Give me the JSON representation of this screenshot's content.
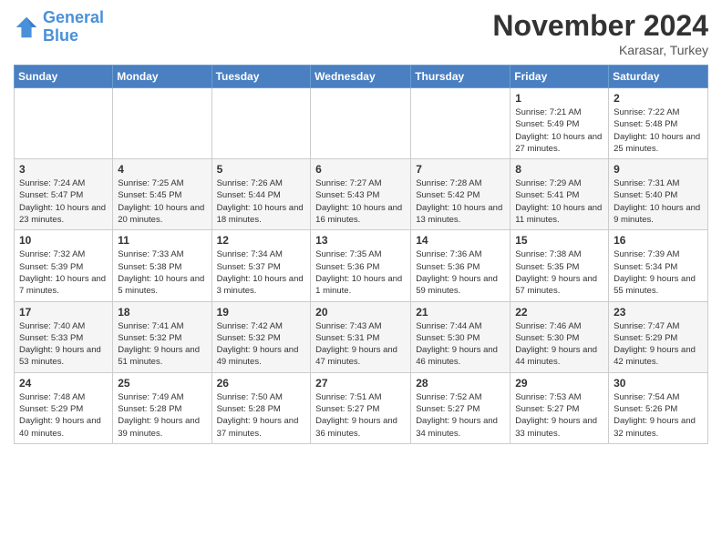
{
  "logo": {
    "line1": "General",
    "line2": "Blue"
  },
  "title": "November 2024",
  "location": "Karasar, Turkey",
  "days_header": [
    "Sunday",
    "Monday",
    "Tuesday",
    "Wednesday",
    "Thursday",
    "Friday",
    "Saturday"
  ],
  "weeks": [
    [
      {
        "day": "",
        "info": ""
      },
      {
        "day": "",
        "info": ""
      },
      {
        "day": "",
        "info": ""
      },
      {
        "day": "",
        "info": ""
      },
      {
        "day": "",
        "info": ""
      },
      {
        "day": "1",
        "info": "Sunrise: 7:21 AM\nSunset: 5:49 PM\nDaylight: 10 hours and 27 minutes."
      },
      {
        "day": "2",
        "info": "Sunrise: 7:22 AM\nSunset: 5:48 PM\nDaylight: 10 hours and 25 minutes."
      }
    ],
    [
      {
        "day": "3",
        "info": "Sunrise: 7:24 AM\nSunset: 5:47 PM\nDaylight: 10 hours and 23 minutes."
      },
      {
        "day": "4",
        "info": "Sunrise: 7:25 AM\nSunset: 5:45 PM\nDaylight: 10 hours and 20 minutes."
      },
      {
        "day": "5",
        "info": "Sunrise: 7:26 AM\nSunset: 5:44 PM\nDaylight: 10 hours and 18 minutes."
      },
      {
        "day": "6",
        "info": "Sunrise: 7:27 AM\nSunset: 5:43 PM\nDaylight: 10 hours and 16 minutes."
      },
      {
        "day": "7",
        "info": "Sunrise: 7:28 AM\nSunset: 5:42 PM\nDaylight: 10 hours and 13 minutes."
      },
      {
        "day": "8",
        "info": "Sunrise: 7:29 AM\nSunset: 5:41 PM\nDaylight: 10 hours and 11 minutes."
      },
      {
        "day": "9",
        "info": "Sunrise: 7:31 AM\nSunset: 5:40 PM\nDaylight: 10 hours and 9 minutes."
      }
    ],
    [
      {
        "day": "10",
        "info": "Sunrise: 7:32 AM\nSunset: 5:39 PM\nDaylight: 10 hours and 7 minutes."
      },
      {
        "day": "11",
        "info": "Sunrise: 7:33 AM\nSunset: 5:38 PM\nDaylight: 10 hours and 5 minutes."
      },
      {
        "day": "12",
        "info": "Sunrise: 7:34 AM\nSunset: 5:37 PM\nDaylight: 10 hours and 3 minutes."
      },
      {
        "day": "13",
        "info": "Sunrise: 7:35 AM\nSunset: 5:36 PM\nDaylight: 10 hours and 1 minute."
      },
      {
        "day": "14",
        "info": "Sunrise: 7:36 AM\nSunset: 5:36 PM\nDaylight: 9 hours and 59 minutes."
      },
      {
        "day": "15",
        "info": "Sunrise: 7:38 AM\nSunset: 5:35 PM\nDaylight: 9 hours and 57 minutes."
      },
      {
        "day": "16",
        "info": "Sunrise: 7:39 AM\nSunset: 5:34 PM\nDaylight: 9 hours and 55 minutes."
      }
    ],
    [
      {
        "day": "17",
        "info": "Sunrise: 7:40 AM\nSunset: 5:33 PM\nDaylight: 9 hours and 53 minutes."
      },
      {
        "day": "18",
        "info": "Sunrise: 7:41 AM\nSunset: 5:32 PM\nDaylight: 9 hours and 51 minutes."
      },
      {
        "day": "19",
        "info": "Sunrise: 7:42 AM\nSunset: 5:32 PM\nDaylight: 9 hours and 49 minutes."
      },
      {
        "day": "20",
        "info": "Sunrise: 7:43 AM\nSunset: 5:31 PM\nDaylight: 9 hours and 47 minutes."
      },
      {
        "day": "21",
        "info": "Sunrise: 7:44 AM\nSunset: 5:30 PM\nDaylight: 9 hours and 46 minutes."
      },
      {
        "day": "22",
        "info": "Sunrise: 7:46 AM\nSunset: 5:30 PM\nDaylight: 9 hours and 44 minutes."
      },
      {
        "day": "23",
        "info": "Sunrise: 7:47 AM\nSunset: 5:29 PM\nDaylight: 9 hours and 42 minutes."
      }
    ],
    [
      {
        "day": "24",
        "info": "Sunrise: 7:48 AM\nSunset: 5:29 PM\nDaylight: 9 hours and 40 minutes."
      },
      {
        "day": "25",
        "info": "Sunrise: 7:49 AM\nSunset: 5:28 PM\nDaylight: 9 hours and 39 minutes."
      },
      {
        "day": "26",
        "info": "Sunrise: 7:50 AM\nSunset: 5:28 PM\nDaylight: 9 hours and 37 minutes."
      },
      {
        "day": "27",
        "info": "Sunrise: 7:51 AM\nSunset: 5:27 PM\nDaylight: 9 hours and 36 minutes."
      },
      {
        "day": "28",
        "info": "Sunrise: 7:52 AM\nSunset: 5:27 PM\nDaylight: 9 hours and 34 minutes."
      },
      {
        "day": "29",
        "info": "Sunrise: 7:53 AM\nSunset: 5:27 PM\nDaylight: 9 hours and 33 minutes."
      },
      {
        "day": "30",
        "info": "Sunrise: 7:54 AM\nSunset: 5:26 PM\nDaylight: 9 hours and 32 minutes."
      }
    ]
  ]
}
